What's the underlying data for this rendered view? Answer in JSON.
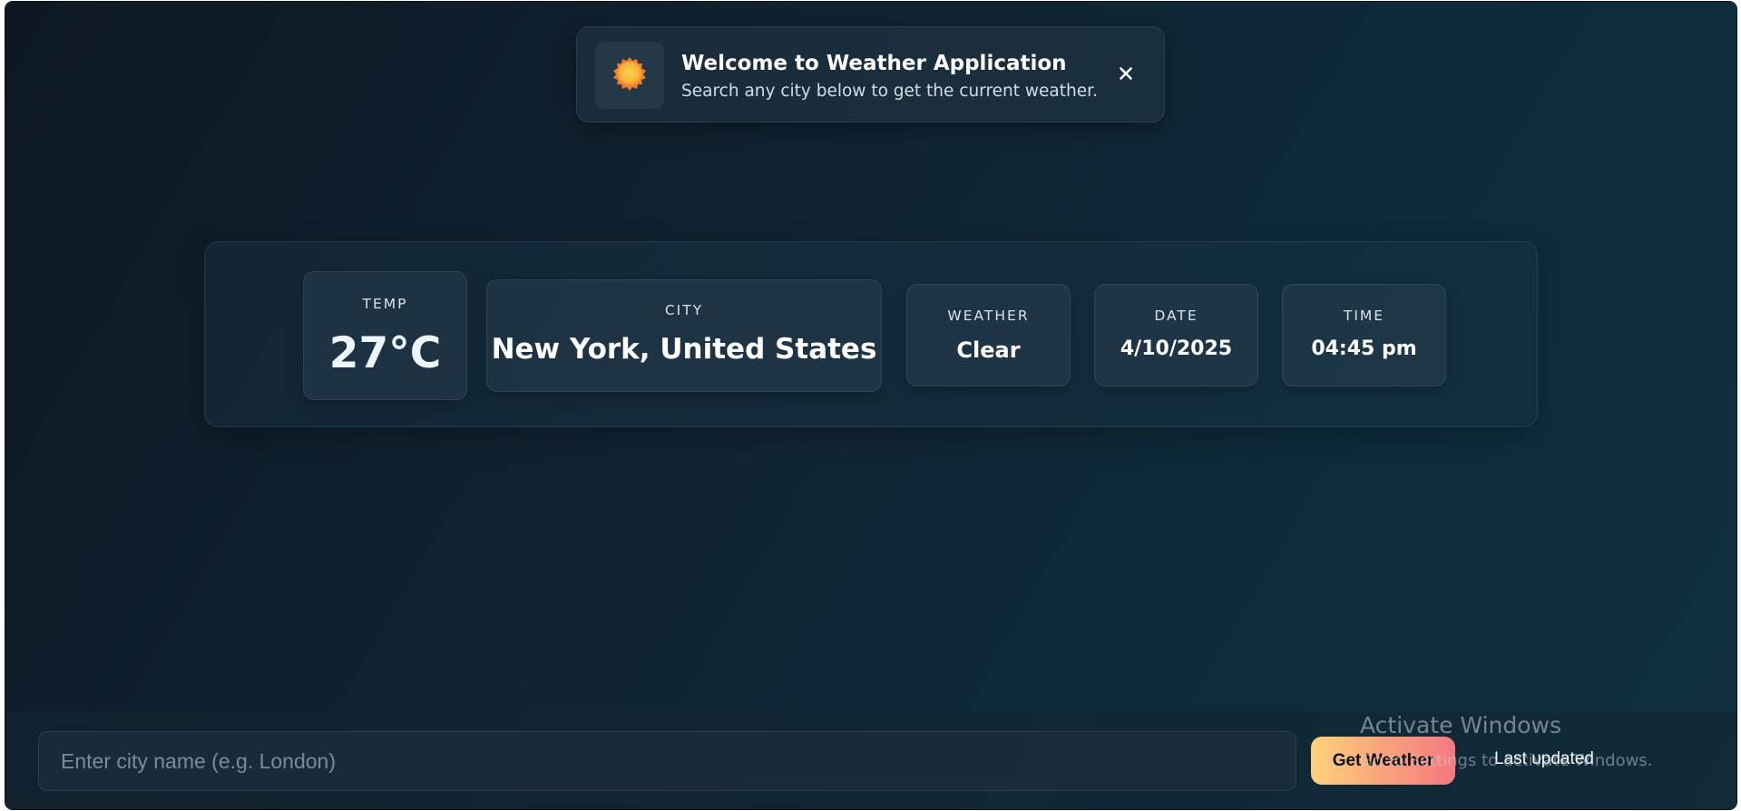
{
  "toast": {
    "icon": "sun-icon",
    "title": "Welcome to Weather Application",
    "subtitle": "Search any city below to get the current weather.",
    "close_symbol": "✕"
  },
  "weather": {
    "temp": {
      "label": "TEMP",
      "value": "27°C"
    },
    "city": {
      "label": "CITY",
      "value": "New York, United States"
    },
    "condition": {
      "label": "WEATHER",
      "value": "Clear"
    },
    "date": {
      "label": "DATE",
      "value": "4/10/2025"
    },
    "time": {
      "label": "TIME",
      "value": "04:45 pm"
    }
  },
  "search": {
    "placeholder": "Enter city name (e.g. London)",
    "value": "",
    "button_label": "Get Weather",
    "last_updated": "Last updated"
  },
  "watermark": {
    "title": "Activate Windows",
    "subtitle": "Go to Settings to activate Windows."
  },
  "colors": {
    "accent_start": "#fcd27b",
    "accent_end": "#f5787f",
    "sun": "#f7b13a"
  }
}
